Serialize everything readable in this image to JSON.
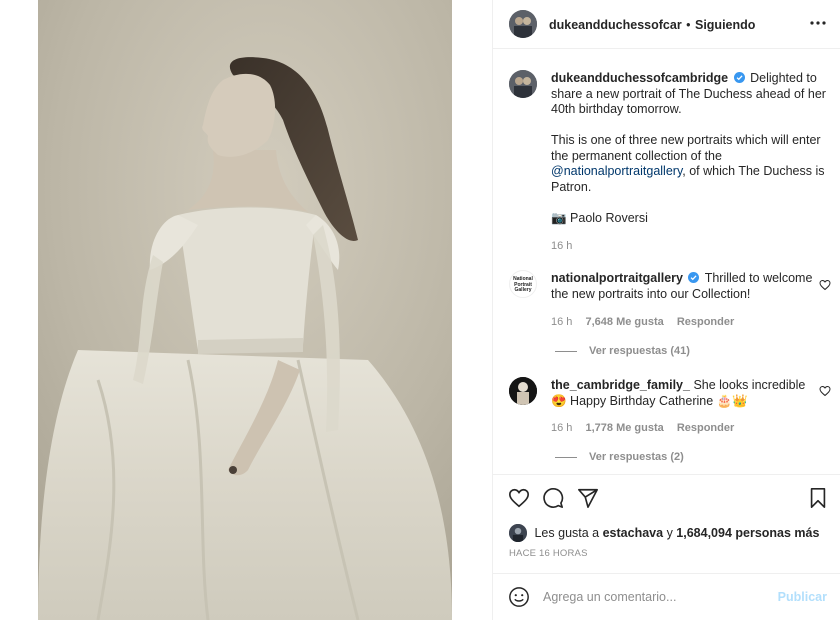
{
  "post": {
    "author": "dukeandduchessofcambridge",
    "header_author": "dukeandduchessofcar",
    "dot": "•",
    "follow_status": "Siguiendo",
    "caption": {
      "username": "dukeandduchessofcambridge",
      "para1": "Delighted to share a new portrait of The Duchess ahead of her 40th birthday tomorrow.",
      "para2_before": "This is one of three new portraits which will enter the permanent collection of the ",
      "para2_mention": "@nationalportraitgallery",
      "para2_after": ", of which The Duchess is Patron.",
      "credit": "📷 Paolo Roversi",
      "time": "16 h"
    },
    "comments": [
      {
        "username": "nationalportraitgallery",
        "avatar_text": "National Portrait Gallery",
        "verified": true,
        "text": "Thrilled to welcome the new portraits into our Collection!",
        "time": "16 h",
        "likes": "7,648 Me gusta",
        "reply": "Responder",
        "view_replies": "Ver respuestas (41)"
      },
      {
        "username": "the_cambridge_family_",
        "verified": false,
        "text": "She looks incredible 😍 Happy Birthday Catherine 🎂👑",
        "time": "16 h",
        "likes": "1,778 Me gusta",
        "reply": "Responder",
        "view_replies": "Ver respuestas (2)"
      }
    ],
    "likes_prefix": "Les gusta a",
    "likes_user": "estachava",
    "likes_mid": "y",
    "likes_count": "1,684,094 personas más",
    "timestamp": "HACE 16 HORAS",
    "comment_placeholder": "Agrega un comentario...",
    "publish_label": "Publicar"
  },
  "colors": {
    "link": "#00376b",
    "verified": "#3897f0",
    "muted": "#8e8e8e",
    "publish": "#b2dffc"
  },
  "icons": [
    "more-options-icon",
    "verified-icon",
    "heart-icon",
    "comment-icon",
    "share-icon",
    "bookmark-icon",
    "emoji-icon"
  ]
}
